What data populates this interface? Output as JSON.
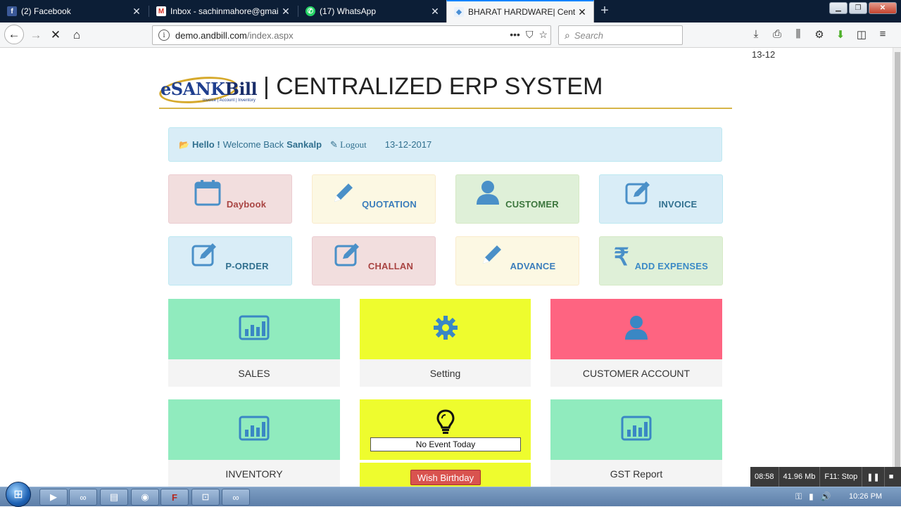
{
  "browser": {
    "tabs": [
      {
        "title": "(2) Facebook",
        "icon": "facebook-icon",
        "favicon_letter": "f",
        "favicon_color": "#3b5998",
        "active": false
      },
      {
        "title": "Inbox - sachinmahore@gmail.c",
        "icon": "gmail-icon",
        "favicon_letter": "M",
        "favicon_color": "#d93025",
        "active": false
      },
      {
        "title": "(17) WhatsApp",
        "icon": "whatsapp-icon",
        "favicon_letter": "✆",
        "favicon_color": "#25d366",
        "active": false
      },
      {
        "title": "BHARAT HARDWARE| Centraliz",
        "icon": "site-icon",
        "favicon_letter": "◆",
        "favicon_color": "#4a8fd4",
        "active": true
      }
    ],
    "new_tab": "+",
    "url_host": "demo.andbill.com",
    "url_path": "/index.aspx",
    "search_placeholder": "Search",
    "corner_text": "13-12"
  },
  "header": {
    "logo_e": "e",
    "logo_sank": "SANK",
    "logo_bill": "Bill",
    "logo_tagline": "Invoice | Account | Inventory",
    "title": "| CENTRALIZED ERP SYSTEM"
  },
  "welcome": {
    "hello": "Hello !",
    "text": "Welcome Back",
    "user": "Sankalp",
    "logout": "Logout",
    "date": "13-12-2017"
  },
  "tiles": [
    {
      "label": "Daybook",
      "icon": "calendar-icon",
      "glyph": "📅",
      "color": "red"
    },
    {
      "label": "QUOTATION",
      "icon": "pencil-icon",
      "glyph": "✎",
      "color": "yellow"
    },
    {
      "label": "CUSTOMER",
      "icon": "user-icon",
      "glyph": "●",
      "color": "green"
    },
    {
      "label": "INVOICE",
      "icon": "edit-icon",
      "glyph": "✎",
      "color": "blue"
    },
    {
      "label": "P-ORDER",
      "icon": "edit-icon",
      "glyph": "✎",
      "color": "blue"
    },
    {
      "label": "CHALLAN",
      "icon": "edit-icon",
      "glyph": "✎",
      "color": "red"
    },
    {
      "label": "ADVANCE",
      "icon": "pencil-icon",
      "glyph": "✎",
      "color": "yellow"
    },
    {
      "label": "ADD EXPENSES",
      "icon": "rupee-icon",
      "glyph": "₹",
      "color": "green"
    }
  ],
  "cards": [
    {
      "label": "SALES",
      "icon": "bar-chart-icon",
      "color": "#90ebbe"
    },
    {
      "label": "Setting",
      "icon": "gear-icon",
      "color": "#eefc2e"
    },
    {
      "label": "CUSTOMER ACCOUNT",
      "icon": "user-icon",
      "color": "#fe6481"
    },
    {
      "label": "INVENTORY",
      "icon": "bar-chart-icon",
      "color": "#90ebbe"
    },
    {
      "label": "GST Report",
      "icon": "bar-chart-icon",
      "color": "#90ebbe"
    }
  ],
  "birthday": {
    "icon": "lightbulb-icon",
    "no_event": "No Event Today",
    "wish_button": "Wish Birthday"
  },
  "recorder": {
    "time": "08:58",
    "size": "41.96 Mb",
    "stop": "F11: Stop"
  },
  "taskbar": {
    "clock": "10:26 PM"
  }
}
